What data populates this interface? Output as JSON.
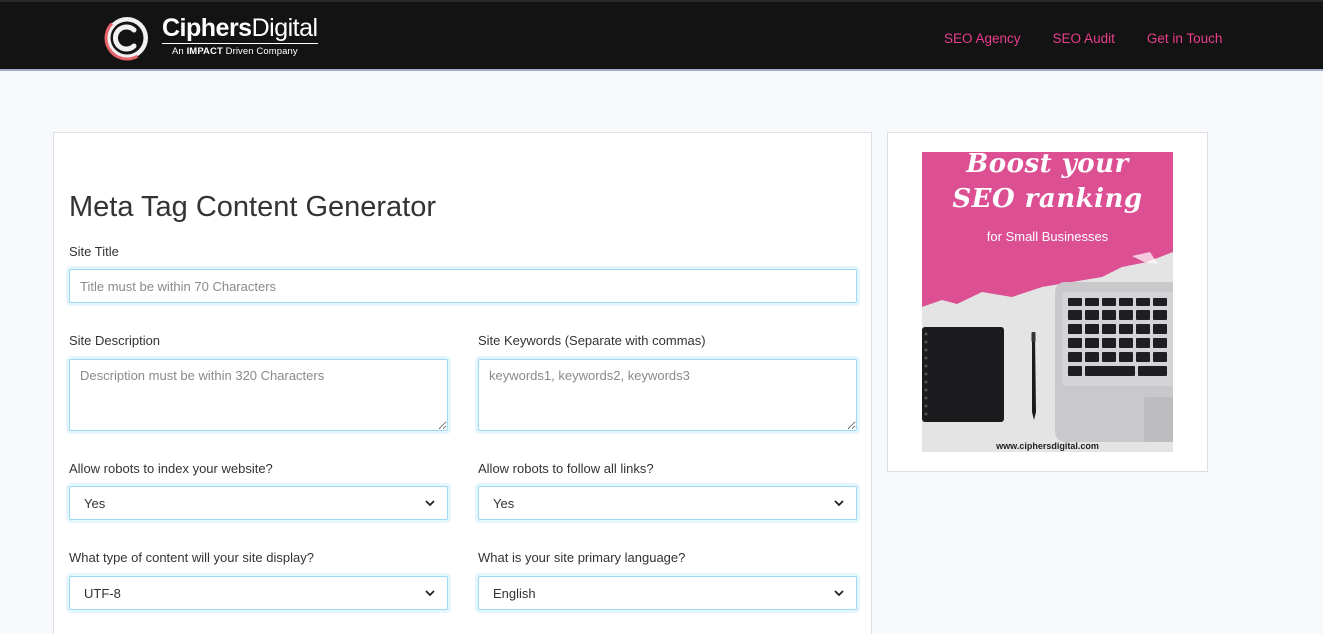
{
  "brand": {
    "name_bold": "Ciphers",
    "name_light": "Digital",
    "tagline_pre": "An ",
    "tagline_bold": "IMPACT",
    "tagline_post": " Driven Company"
  },
  "nav": {
    "links": [
      "SEO Agency",
      "SEO Audit",
      "Get in Touch"
    ]
  },
  "form": {
    "title": "Meta Tag Content Generator",
    "site_title": {
      "label": "Site Title",
      "placeholder": "Title must be within 70 Characters",
      "value": ""
    },
    "site_description": {
      "label": "Site Description",
      "placeholder": "Description must be within 320 Characters",
      "value": ""
    },
    "site_keywords": {
      "label": "Site Keywords (Separate with commas)",
      "placeholder": "keywords1, keywords2, keywords3",
      "value": ""
    },
    "robots_index": {
      "label": "Allow robots to index your website?",
      "selected": "Yes"
    },
    "robots_follow": {
      "label": "Allow robots to follow all links?",
      "selected": "Yes"
    },
    "content_type": {
      "label": "What type of content will your site display?",
      "selected": "UTF-8"
    },
    "language": {
      "label": "What is your site primary language?",
      "selected": "English"
    }
  },
  "ad": {
    "line1": "Boost your",
    "line2": "SEO ranking",
    "line3": "for Small Businesses",
    "url": "www.ciphersdigital.com"
  },
  "colors": {
    "nav_bg": "#131313",
    "nav_link": "#e83e8c",
    "page_bg": "#f8f9fb",
    "input_border": "#9ed8f2",
    "ad_pink": "#dc4f93"
  }
}
